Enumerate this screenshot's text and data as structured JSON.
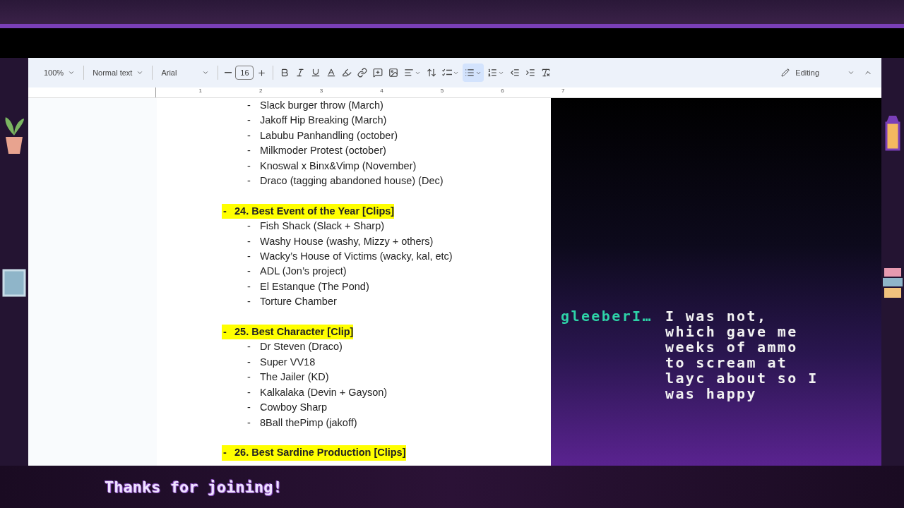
{
  "toolbar": {
    "zoom": "100%",
    "style": "Normal text",
    "font": "Arial",
    "font_size": "16",
    "tools": [
      {
        "kind": "bold",
        "selected": false,
        "menu": false
      },
      {
        "kind": "italic",
        "selected": false,
        "menu": false
      },
      {
        "kind": "underline",
        "selected": false,
        "menu": false
      },
      {
        "kind": "text-color",
        "selected": false,
        "menu": false
      },
      {
        "kind": "highlight",
        "selected": false,
        "menu": false
      },
      {
        "kind": "link",
        "selected": false,
        "menu": false
      },
      {
        "kind": "comment",
        "selected": false,
        "menu": false
      },
      {
        "kind": "image",
        "selected": false,
        "menu": false
      },
      {
        "kind": "align",
        "selected": false,
        "menu": true
      },
      {
        "kind": "line-spacing",
        "selected": false,
        "menu": false
      },
      {
        "kind": "task-list",
        "selected": false,
        "menu": true
      },
      {
        "kind": "bullet-list",
        "selected": true,
        "menu": true
      },
      {
        "kind": "numbered-list",
        "selected": false,
        "menu": true
      },
      {
        "kind": "indent-decrease",
        "selected": false,
        "menu": false
      },
      {
        "kind": "indent-increase",
        "selected": false,
        "menu": false
      },
      {
        "kind": "clear-format",
        "selected": false,
        "menu": false
      }
    ],
    "mode": "Editing"
  },
  "ruler": [
    "1",
    "2",
    "3",
    "4",
    "5",
    "6",
    "7"
  ],
  "document": {
    "sections": [
      {
        "items": [
          {
            "bullet": "-",
            "text": "Slack burger throw (March)"
          },
          {
            "bullet": "-",
            "text": "Jakoff Hip Breaking (March)"
          },
          {
            "bullet": "-",
            "text": "Labubu Panhandling (october)"
          },
          {
            "bullet": "-",
            "text": "Milkmoder Protest (october)"
          },
          {
            "bullet": "-",
            "text": "Knoswal x Binx&Vimp (November)"
          },
          {
            "bullet": "-",
            "text": "Draco (tagging abandoned house) (Dec)"
          }
        ]
      },
      {
        "heading": {
          "bullet": "-",
          "text": "24. Best Event of the Year [Clips]"
        },
        "items": [
          {
            "bullet": "-",
            "text": "Fish Shack (Slack + Sharp)"
          },
          {
            "bullet": "-",
            "text": "Washy House (washy, Mizzy + others)"
          },
          {
            "bullet": "-",
            "text": "Wacky’s House of Victims (wacky, kal, etc)"
          },
          {
            "bullet": "-",
            "text": "ADL (Jon’s project)"
          },
          {
            "bullet": "-",
            "text": "El Estanque (The Pond)"
          },
          {
            "bullet": "-",
            "text": "Torture Chamber"
          }
        ]
      },
      {
        "heading": {
          "bullet": "-",
          "text": "25. Best Character [Clip]"
        },
        "items": [
          {
            "bullet": "-",
            "text": "Dr Steven (Draco)"
          },
          {
            "bullet": "-",
            "text": "Super VV18"
          },
          {
            "bullet": "-",
            "text": "The Jailer (KD)"
          },
          {
            "bullet": "-",
            "text": "Kalkalaka (Devin + Gayson)"
          },
          {
            "bullet": "-",
            "text": "Cowboy Sharp"
          },
          {
            "bullet": "-",
            "text": "8Ball thePimp (jakoff)"
          }
        ]
      },
      {
        "heading": {
          "bullet": "-",
          "text": "26. Best Sardine Production [Clips]"
        }
      }
    ]
  },
  "chat": {
    "user": "gleeberI…",
    "message": "I was not, which gave me weeks of ammo to scream at layc about so I was happy"
  },
  "banner": "Thanks for joining!"
}
